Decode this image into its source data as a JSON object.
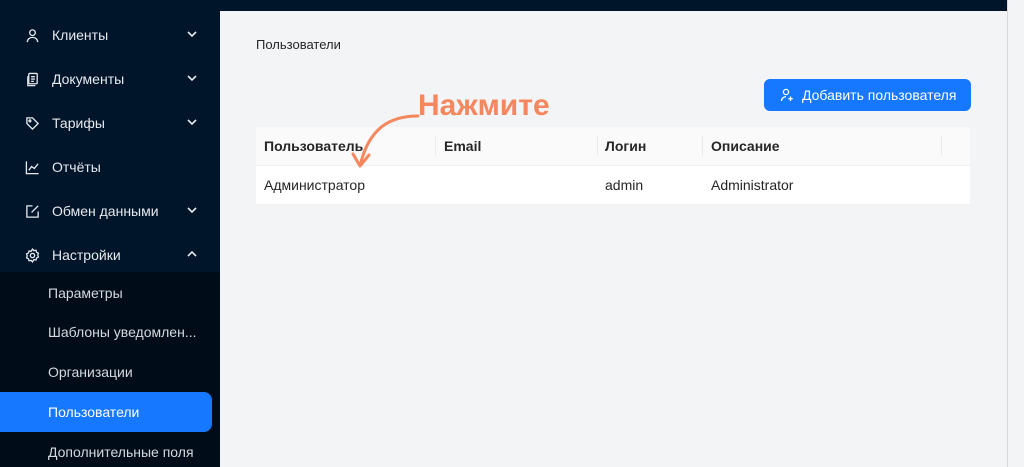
{
  "sidebar": {
    "items": [
      {
        "label": "Клиенты",
        "icon": "user-icon",
        "expandable": true,
        "expanded": false
      },
      {
        "label": "Документы",
        "icon": "documents-icon",
        "expandable": true,
        "expanded": false
      },
      {
        "label": "Тарифы",
        "icon": "tag-icon",
        "expandable": true,
        "expanded": false
      },
      {
        "label": "Отчёты",
        "icon": "line-chart-icon",
        "expandable": false
      },
      {
        "label": "Обмен данными",
        "icon": "edit-square-icon",
        "expandable": true,
        "expanded": false
      },
      {
        "label": "Настройки",
        "icon": "gear-icon",
        "expandable": true,
        "expanded": true
      }
    ],
    "settings_submenu": [
      {
        "label": "Параметры"
      },
      {
        "label": "Шаблоны уведомлен..."
      },
      {
        "label": "Организации"
      },
      {
        "label": "Пользователи",
        "active": true
      },
      {
        "label": "Дополнительные поля"
      }
    ]
  },
  "main": {
    "page_title": "Пользователи",
    "add_button_label": "Добавить пользователя",
    "annotation": "Нажмите",
    "table": {
      "columns": [
        "Пользователь",
        "Email",
        "Логин",
        "Описание"
      ],
      "rows": [
        {
          "user": "Администратор",
          "email": "",
          "login": "admin",
          "description": "Administrator"
        }
      ]
    }
  },
  "colors": {
    "sidebar_bg": "#001529",
    "submenu_bg": "#000c17",
    "accent": "#1677ff",
    "annotation": "#f5875e",
    "content_bg": "#f3f4f6"
  }
}
